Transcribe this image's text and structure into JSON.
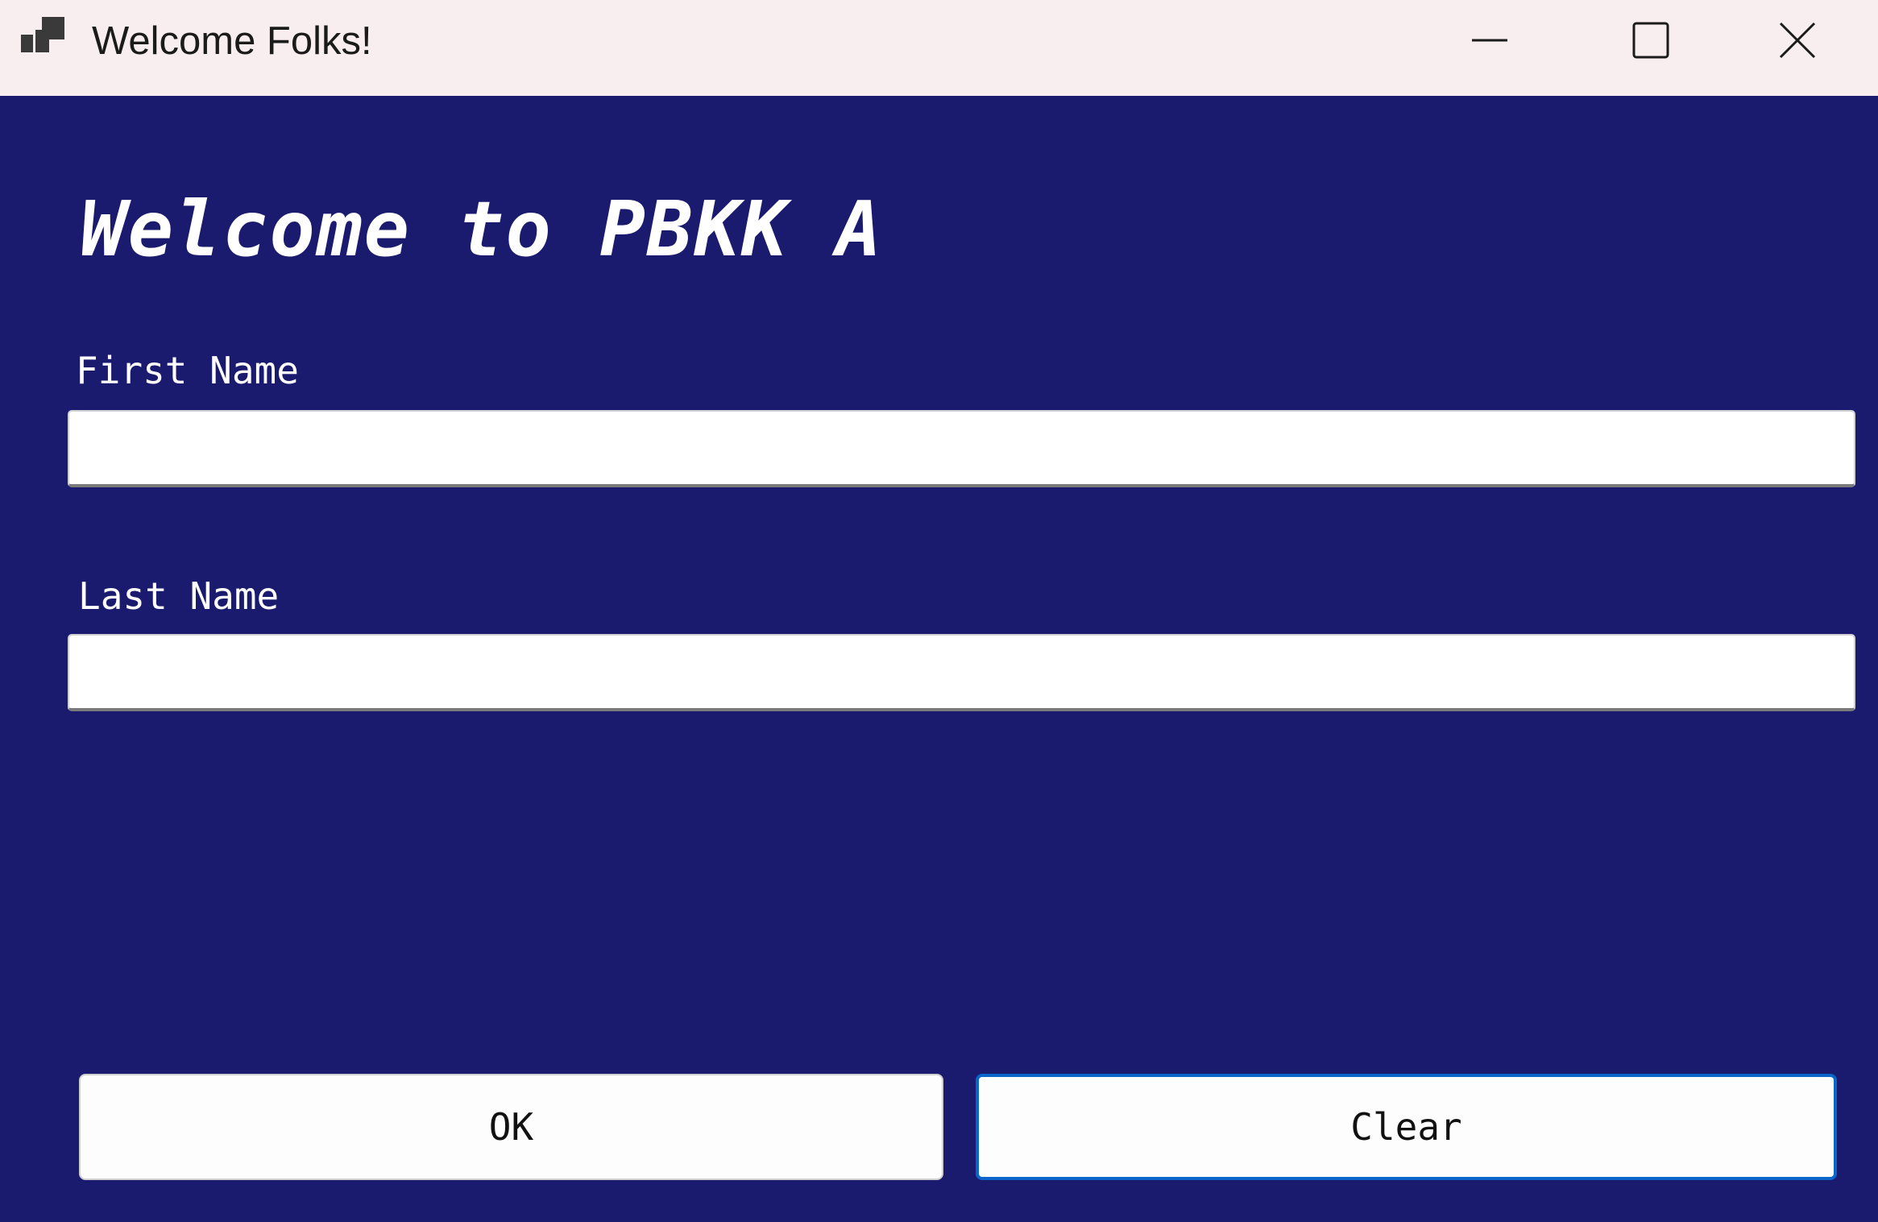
{
  "window": {
    "title": "Welcome Folks!",
    "icon": "app-window-icon",
    "controls": {
      "minimize_icon": "minimize-icon",
      "maximize_icon": "maximize-icon",
      "close_icon": "close-icon"
    }
  },
  "form": {
    "heading": "Welcome to PBKK A",
    "first_name": {
      "label": "First Name",
      "value": "",
      "placeholder": ""
    },
    "last_name": {
      "label": "Last Name",
      "value": "",
      "placeholder": ""
    },
    "buttons": {
      "ok_label": "OK",
      "clear_label": "Clear",
      "focused": "Clear"
    }
  },
  "colors": {
    "background": "#1a1a6e",
    "titlebar": "#f8eef0",
    "focus_border": "#0a66c8",
    "text_on_background": "#ffffff"
  }
}
